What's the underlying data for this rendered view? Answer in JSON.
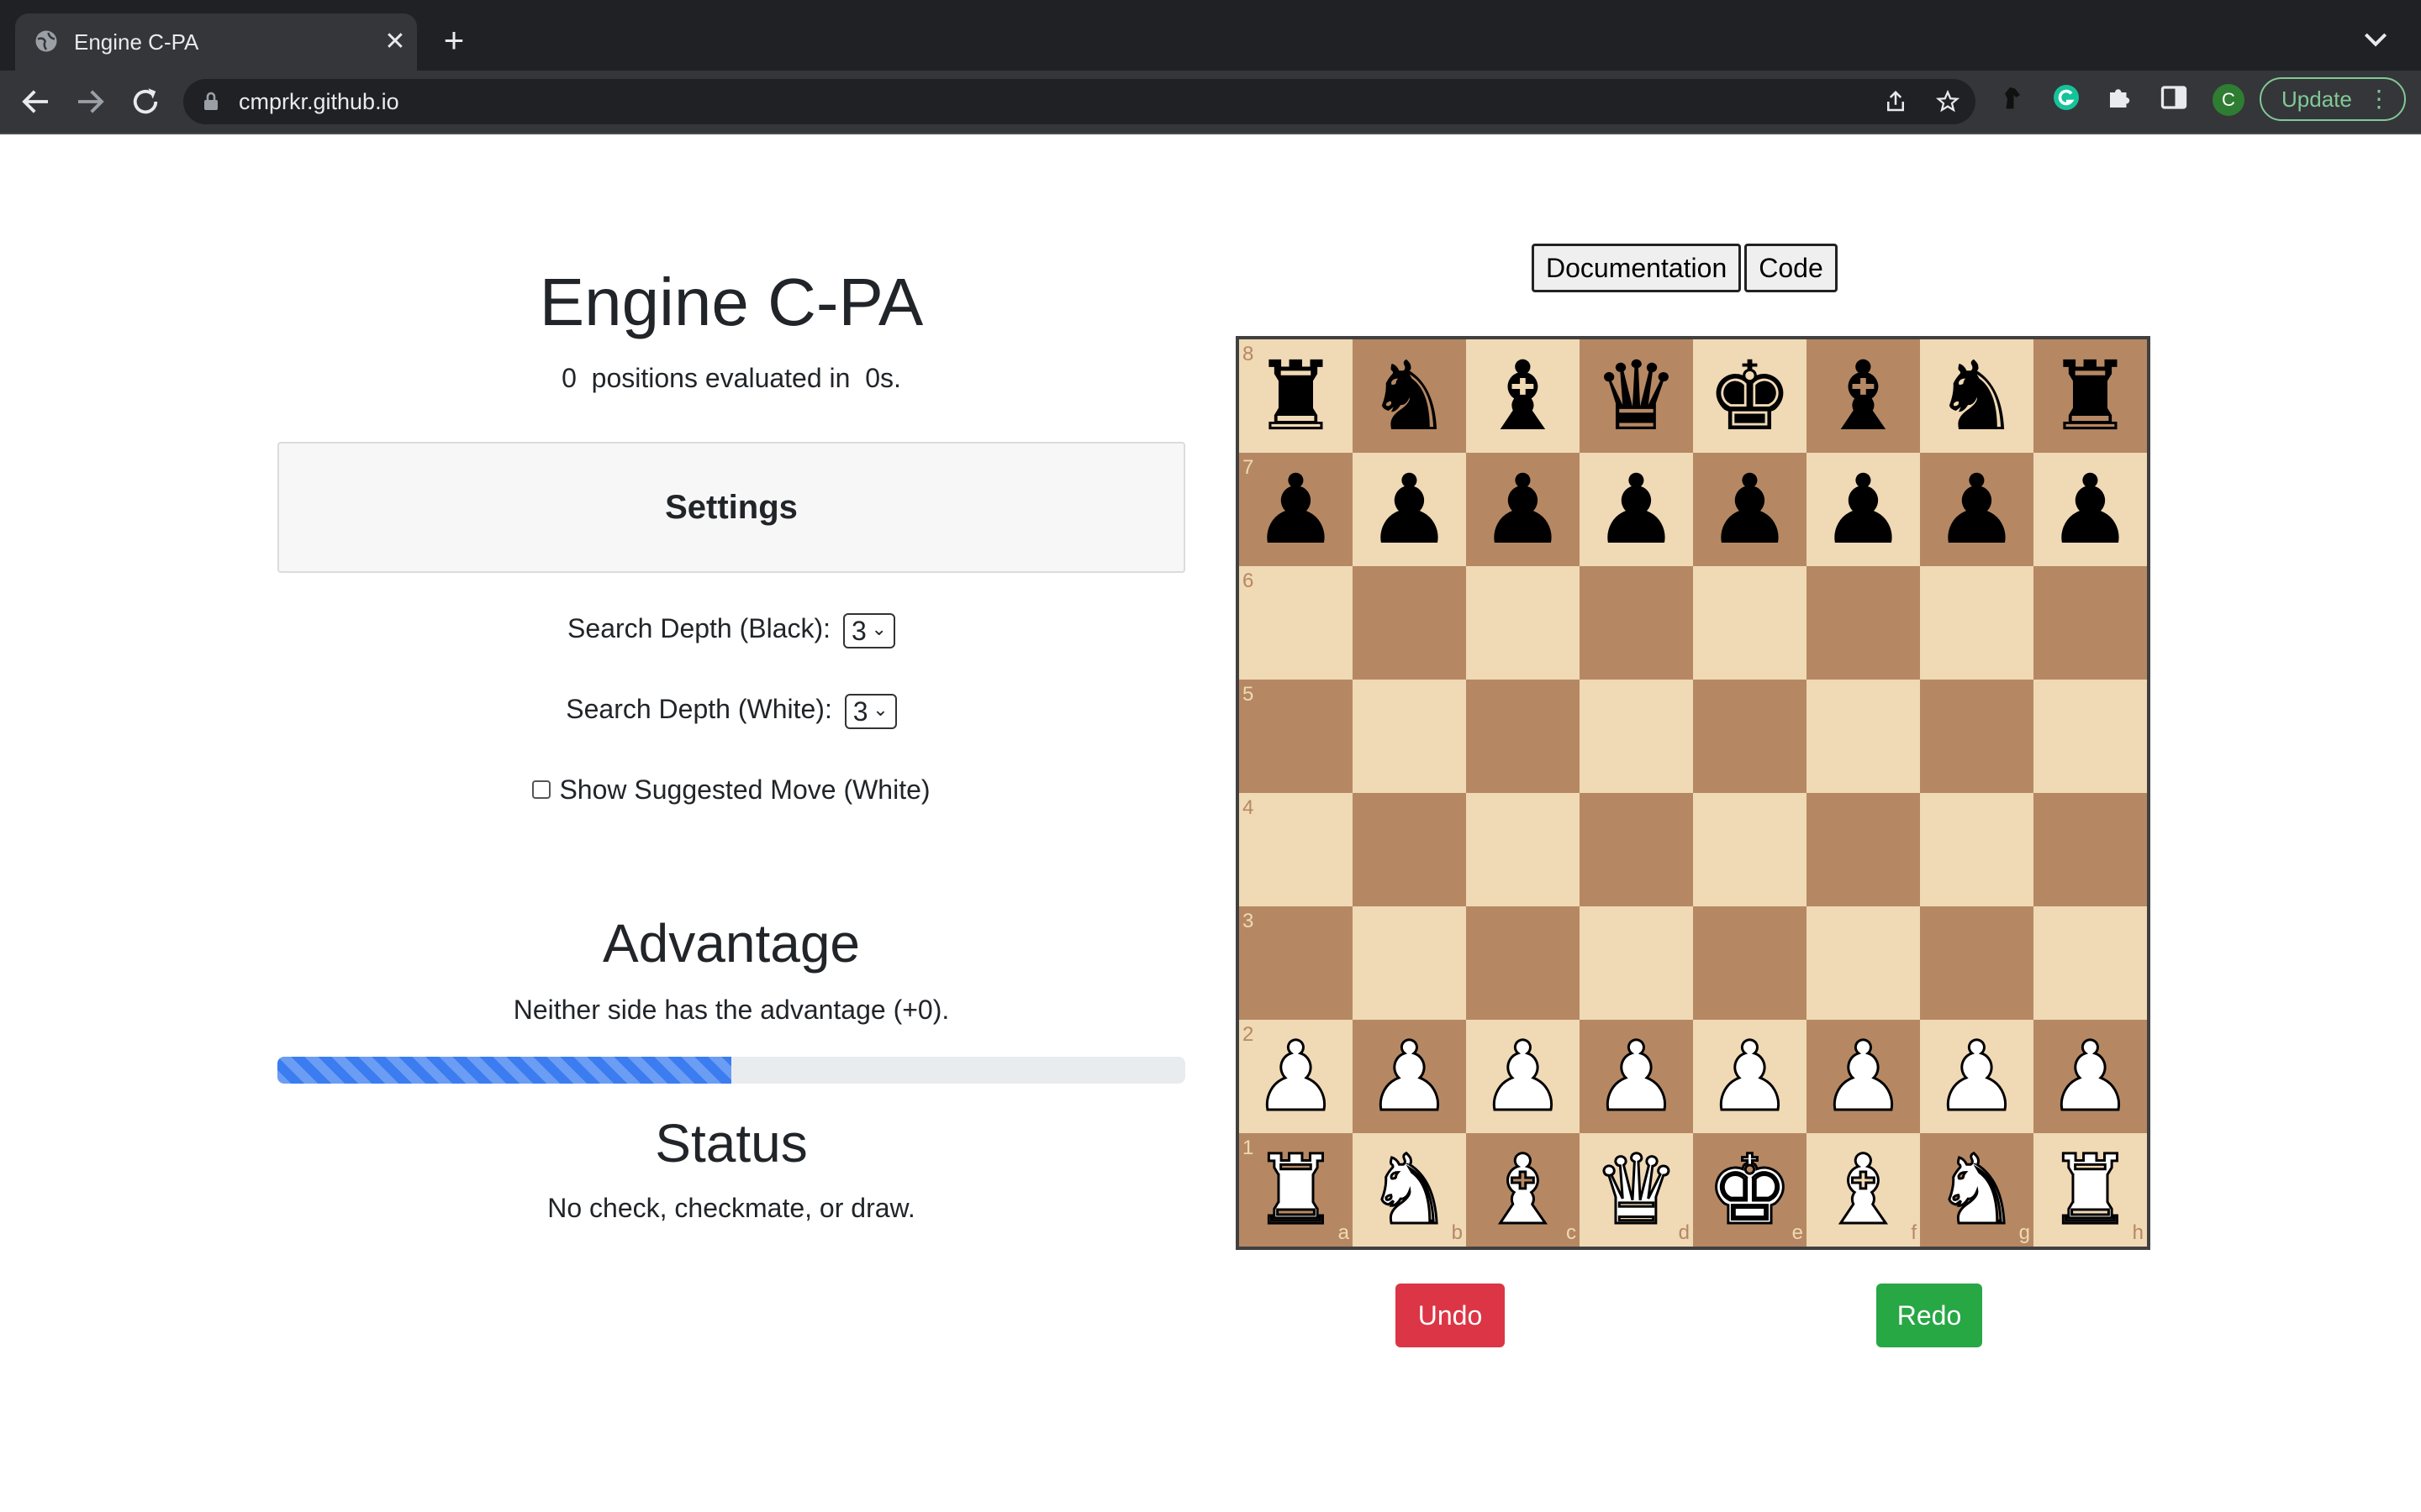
{
  "browser": {
    "tab_title": "Engine C-PA",
    "url": "cmprkr.github.io",
    "profile_initial": "C",
    "update_label": "Update"
  },
  "page": {
    "title": "Engine C-PA",
    "evaluated_text": "0  positions evaluated in  0s.",
    "settings": {
      "title": "Settings",
      "depth_black_label": "Search Depth (Black):",
      "depth_black_value": "3",
      "depth_white_label": "Search Depth (White):",
      "depth_white_value": "3",
      "suggest_label": "Show Suggested Move (White)",
      "suggest_checked": false
    },
    "advantage": {
      "title": "Advantage",
      "text": "Neither side has the advantage (+0).",
      "bar_fraction": 0.5
    },
    "status": {
      "title": "Status",
      "text": "No check, checkmate, or draw."
    },
    "links": [
      "Documentation",
      "Code"
    ],
    "undo_label": "Undo",
    "redo_label": "Redo"
  },
  "board": {
    "ranks": [
      "8",
      "7",
      "6",
      "5",
      "4",
      "3",
      "2",
      "1"
    ],
    "files": [
      "a",
      "b",
      "c",
      "d",
      "e",
      "f",
      "g",
      "h"
    ],
    "rows": [
      [
        "bR",
        "bN",
        "bB",
        "bQ",
        "bK",
        "bB",
        "bN",
        "bR"
      ],
      [
        "bP",
        "bP",
        "bP",
        "bP",
        "bP",
        "bP",
        "bP",
        "bP"
      ],
      [
        "",
        "",
        "",
        "",
        "",
        "",
        "",
        ""
      ],
      [
        "",
        "",
        "",
        "",
        "",
        "",
        "",
        ""
      ],
      [
        "",
        "",
        "",
        "",
        "",
        "",
        "",
        ""
      ],
      [
        "",
        "",
        "",
        "",
        "",
        "",
        "",
        ""
      ],
      [
        "wP",
        "wP",
        "wP",
        "wP",
        "wP",
        "wP",
        "wP",
        "wP"
      ],
      [
        "wR",
        "wN",
        "wB",
        "wQ",
        "wK",
        "wB",
        "wN",
        "wR"
      ]
    ],
    "light_color": "#f0d9b5",
    "dark_color": "#b58863"
  },
  "colors": {
    "undo": "#dc3545",
    "redo": "#28a745",
    "progress": "#3b7cf0"
  }
}
